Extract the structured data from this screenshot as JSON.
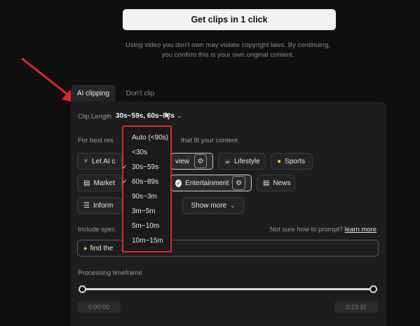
{
  "cta": {
    "label": "Get clips in 1 click"
  },
  "disclaimer": {
    "line1": "Using video you don't own may violate copyright laws. By continuing,",
    "line2": "you confirm this is your own original content."
  },
  "tabs": [
    {
      "label": "AI clipping"
    },
    {
      "label": "Don't clip"
    }
  ],
  "clip_length": {
    "label": "Clip Length",
    "value": "30s~59s, 60s~89s"
  },
  "best_results": {
    "prefix": "For best res",
    "suffix": "that fit your content"
  },
  "chips": {
    "let_ai": "Let AI c",
    "review": "view",
    "lifestyle": "Lifestyle",
    "sports": "Sports",
    "marketing": "Market",
    "entertainment": "Entertainment",
    "news": "News",
    "info": "Inform",
    "show_more": "Show more"
  },
  "prompt": {
    "label": "Include spec",
    "hint": "Not sure how to prompt?",
    "learn_more": "learn more",
    "value": "find the"
  },
  "timeframe": {
    "label": "Processing timeframe",
    "start": "0:00:00",
    "end": "0:23:31"
  },
  "dropdown": {
    "items": [
      {
        "label": "Auto (<90s)",
        "checked": false
      },
      {
        "label": "<30s",
        "checked": false
      },
      {
        "label": "30s~59s",
        "checked": true
      },
      {
        "label": "60s~89s",
        "checked": true
      },
      {
        "label": "90s~3m",
        "checked": false
      },
      {
        "label": "3m~5m",
        "checked": false
      },
      {
        "label": "5m~10m",
        "checked": false
      },
      {
        "label": "10m~15m",
        "checked": false
      }
    ]
  },
  "colors": {
    "highlight_red": "#e0262b",
    "background": "#0f0f10",
    "panel": "#1d1d1f"
  }
}
